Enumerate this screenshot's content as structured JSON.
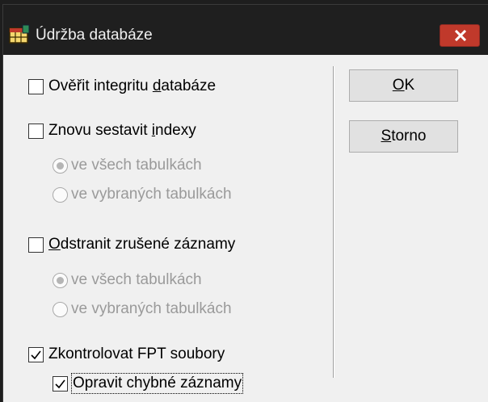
{
  "window": {
    "title": "Údržba databáze",
    "icon": "database-table-icon"
  },
  "options": {
    "verify": {
      "label_pre": "Ověřit integritu ",
      "label_ul": "d",
      "label_post": "atabáze",
      "checked": false
    },
    "reindex": {
      "label_pre": "Znovu sestavit ",
      "label_ul": "i",
      "label_post": "ndexy",
      "checked": false
    },
    "reindex_all": {
      "label": "ve všech tabulkách",
      "selected": true
    },
    "reindex_selected": {
      "label": "ve vybraných tabulkách",
      "selected": false
    },
    "purge": {
      "label_ul": "O",
      "label_post": "dstranit zrušené záznamy",
      "checked": false
    },
    "purge_all": {
      "label": "ve všech tabulkách",
      "selected": true
    },
    "purge_selected": {
      "label": "ve vybraných tabulkách",
      "selected": false
    },
    "check_fpt": {
      "label": "Zkontrolovat FPT soubory",
      "checked": true
    },
    "repair": {
      "label": "Opravit chybné záznamy",
      "checked": true
    }
  },
  "buttons": {
    "ok": {
      "label_ul": "O",
      "label_post": "K"
    },
    "cancel": {
      "label_ul": "S",
      "label_post": "torno"
    }
  },
  "colors": {
    "close_button": "#c0392b",
    "disabled_text": "#9a9a9a"
  }
}
